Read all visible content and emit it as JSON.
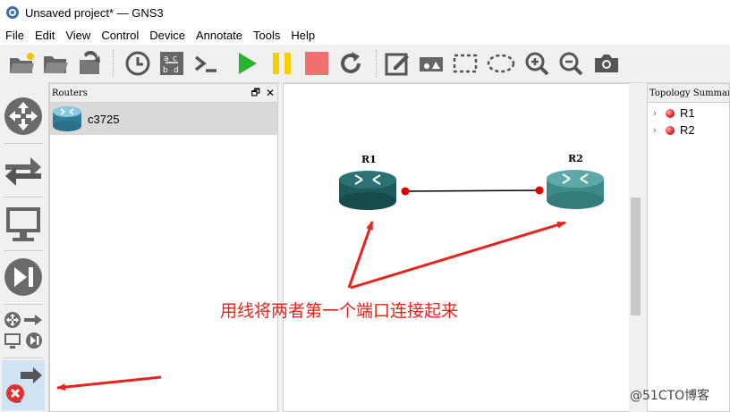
{
  "window": {
    "title": "Unsaved project* — GNS3"
  },
  "menu": [
    "File",
    "Edit",
    "View",
    "Control",
    "Device",
    "Annotate",
    "Tools",
    "Help"
  ],
  "toolbar": {
    "icons": [
      "new-project-icon",
      "open-project-icon",
      "save-project-icon",
      "snapshot-clock-icon",
      "show-interface-labels-icon",
      "console-all-icon",
      "start-all-icon",
      "suspend-all-icon",
      "stop-all-icon",
      "reload-all-icon",
      "add-note-icon",
      "insert-picture-icon",
      "draw-rectangle-icon",
      "draw-ellipse-icon",
      "zoom-in-icon",
      "zoom-out-icon",
      "screenshot-icon"
    ]
  },
  "device_types": [
    "routers-icon",
    "switches-icon",
    "end-devices-icon",
    "security-devices-icon",
    "all-devices-icon",
    "add-link-icon"
  ],
  "routers_panel": {
    "title": "Routers",
    "items": [
      {
        "label": "c3725"
      }
    ]
  },
  "topology": {
    "nodes": [
      {
        "label": "R1"
      },
      {
        "label": "R2"
      }
    ],
    "links": [
      {
        "from": "R1",
        "to": "R2"
      }
    ]
  },
  "topology_summary": {
    "title": "Topology Summary",
    "items": [
      {
        "label": "R1",
        "status": "stopped"
      },
      {
        "label": "R2",
        "status": "stopped"
      }
    ]
  },
  "annotation": {
    "text": "用线将两者第一个端口连接起来",
    "color": "#e8231c"
  },
  "watermark": "@51CTO博客",
  "colors": {
    "accent": "#e8231c",
    "router_dark": "#1f5c5e",
    "router_light": "#3f8e8f",
    "link_endpoint": "#e00000"
  }
}
